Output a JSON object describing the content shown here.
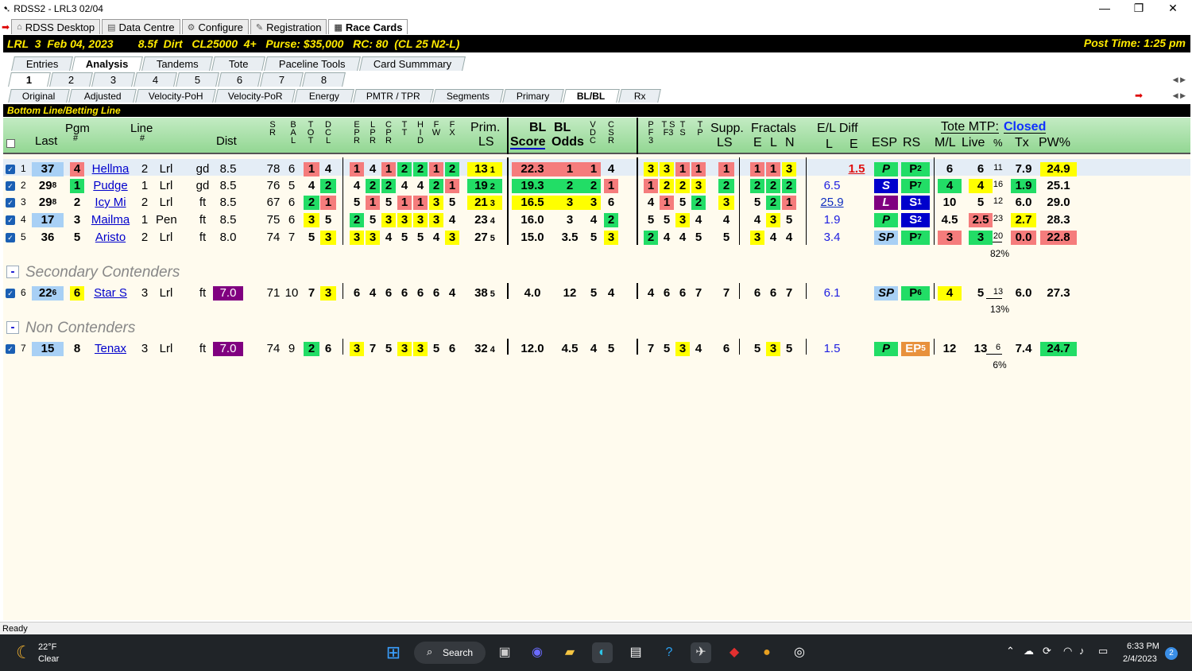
{
  "window": {
    "title": "RDSS2 - LRL3  02/04"
  },
  "app_tabs": [
    {
      "label": "RDSS Desktop"
    },
    {
      "label": "Data Centre"
    },
    {
      "label": "Configure"
    },
    {
      "label": "Registration"
    },
    {
      "label": "Race Cards"
    }
  ],
  "race": {
    "header": "LRL  3  Feb 04, 2023        8.5f  Dirt   CL25000  4+   Purse: $35,000   RC: 80  (CL 25 N2-L)",
    "post_time": "Post Time: 1:25 pm"
  },
  "main_tabs": [
    "Entries",
    "Analysis",
    "Tandems",
    "Tote",
    "Paceline Tools",
    "Card Summmary"
  ],
  "race_tabs": [
    "1",
    "2",
    "3",
    "4",
    "5",
    "6",
    "7",
    "8"
  ],
  "view_tabs": [
    "Original",
    "Adjusted",
    "Velocity-PoH",
    "Velocity-PoR",
    "Energy",
    "PMTR / TPR",
    "Segments",
    "Primary",
    "BL/BL",
    "Rx"
  ],
  "section_title": "Bottom Line/Betting Line",
  "headers": {
    "last": "Last",
    "pgm": "Pgm",
    "pgm_hash": "#",
    "line": "Line",
    "line_hash": "#",
    "dist": "Dist",
    "prim": "Prim.",
    "ls": "LS",
    "bl1": "BL",
    "bl2": "BL",
    "score": "Score",
    "odds": "Odds",
    "supp": "Supp.",
    "supp_ls": "LS",
    "fractals": "Fractals",
    "e": "E",
    "l": "L",
    "n": "N",
    "eldiff": "E/L Diff",
    "el_l": "L",
    "el_e": "E",
    "esp": "ESP",
    "rs": "RS",
    "tote_mtp": "Tote MTP:",
    "tote_status": "Closed",
    "ml": "M/L",
    "live": "Live",
    "pct": "%",
    "tx": "Tx",
    "pw": "PW%"
  },
  "small_headers": {
    "sr": "S R",
    "bal": "B A L",
    "tot": "T O T",
    "dcl": "D C L",
    "epr": "E P R",
    "lpr": "L P R",
    "cpr": "C P R",
    "tt": "T T",
    "hid": "H I D",
    "fw": "F W",
    "fx": "F X",
    "vdc": "V D C",
    "csr": "C S R",
    "pfs": "P F 3",
    "tsf": "T S F3",
    "ts": "T S",
    "tp": "T P"
  },
  "groups": {
    "secondary": "Secondary Contenders",
    "non": "Non Contenders"
  },
  "horses": [
    {
      "n": "1",
      "last": "37",
      "pgm": "4",
      "name": "Hellma",
      "line": "2",
      "trk": "Lrl",
      "sf": "gd",
      "dist": "8.5",
      "sr": "78",
      "bal": "6",
      "tot": "1",
      "dcl": "4",
      "e": [
        "1",
        "4",
        "1",
        "2",
        "2",
        "1",
        "2"
      ],
      "prim": "13",
      "primsub": "1",
      "score": "22.3",
      "odds": "1",
      "vdc": "1",
      "csr": "4",
      "pf": [
        "3",
        "3",
        "1",
        "1"
      ],
      "supp": "1",
      "fr": [
        "1",
        "1",
        "3"
      ],
      "ell": "",
      "ele": "1.5",
      "esp": "P",
      "rs": "P",
      "rssub": "2",
      "ml": "6",
      "live": "6",
      "pct": "11",
      "tx": "7.9",
      "pw": "24.9"
    },
    {
      "n": "2",
      "last": "29",
      "lastsub": "8",
      "pgm": "1",
      "name": "Pudge",
      "line": "1",
      "trk": "Lrl",
      "sf": "gd",
      "dist": "8.5",
      "sr": "76",
      "bal": "5",
      "tot": "4",
      "dcl": "2",
      "e": [
        "4",
        "2",
        "2",
        "4",
        "4",
        "2",
        "1"
      ],
      "prim": "19",
      "primsub": "2",
      "score": "19.3",
      "odds": "2",
      "vdc": "2",
      "csr": "1",
      "pf": [
        "1",
        "2",
        "2",
        "3"
      ],
      "supp": "2",
      "fr": [
        "2",
        "2",
        "2"
      ],
      "ell": "6.5",
      "ele": "",
      "esp": "S",
      "rs": "P",
      "rssub": "7",
      "ml": "4",
      "live": "4",
      "pct": "16",
      "tx": "1.9",
      "pw": "25.1"
    },
    {
      "n": "3",
      "last": "29",
      "lastsub": "8",
      "pgm": "2",
      "name": "Icy Mi",
      "line": "2",
      "trk": "Lrl",
      "sf": "ft",
      "dist": "8.5",
      "sr": "67",
      "bal": "6",
      "tot": "2",
      "dcl": "1",
      "e": [
        "5",
        "1",
        "5",
        "1",
        "1",
        "3",
        "5"
      ],
      "prim": "21",
      "primsub": "3",
      "score": "16.5",
      "odds": "3",
      "vdc": "3",
      "csr": "6",
      "pf": [
        "4",
        "1",
        "5",
        "2"
      ],
      "supp": "3",
      "fr": [
        "5",
        "2",
        "1"
      ],
      "ell": "25.9",
      "ele": "",
      "esp": "L",
      "rs": "S",
      "rssub": "1",
      "ml": "10",
      "live": "5",
      "pct": "12",
      "tx": "6.0",
      "pw": "29.0"
    },
    {
      "n": "4",
      "last": "17",
      "pgm": "3",
      "name": "Mailma",
      "line": "1",
      "trk": "Pen",
      "sf": "ft",
      "dist": "8.5",
      "sr": "75",
      "bal": "6",
      "tot": "3",
      "dcl": "5",
      "e": [
        "2",
        "5",
        "3",
        "3",
        "3",
        "3",
        "4"
      ],
      "prim": "23",
      "primsub": "4",
      "score": "16.0",
      "odds": "3",
      "vdc": "4",
      "csr": "2",
      "pf": [
        "5",
        "5",
        "3",
        "4"
      ],
      "supp": "4",
      "fr": [
        "4",
        "3",
        "5"
      ],
      "ell": "1.9",
      "ele": "",
      "esp": "P",
      "rs": "S",
      "rssub": "2",
      "ml": "4.5",
      "live": "2.5",
      "pct": "23",
      "tx": "2.7",
      "pw": "28.3"
    },
    {
      "n": "5",
      "last": "36",
      "pgm": "5",
      "name": "Aristo",
      "line": "2",
      "trk": "Lrl",
      "sf": "ft",
      "dist": "8.0",
      "sr": "74",
      "bal": "7",
      "tot": "5",
      "dcl": "3",
      "e": [
        "3",
        "3",
        "4",
        "5",
        "5",
        "4",
        "3"
      ],
      "prim": "27",
      "primsub": "5",
      "score": "15.0",
      "odds": "3.5",
      "vdc": "5",
      "csr": "3",
      "pf": [
        "2",
        "4",
        "4",
        "5"
      ],
      "supp": "5",
      "fr": [
        "3",
        "4",
        "4"
      ],
      "ell": "3.4",
      "ele": "",
      "esp": "SP",
      "rs": "P",
      "rssub": "7",
      "ml": "3",
      "live": "3",
      "pct": "20",
      "tx": "0.0",
      "pw": "22.8",
      "sumpct": "82%"
    },
    {
      "n": "6",
      "last": "22",
      "lastsub": "6",
      "pgm": "6",
      "name": "Star S",
      "line": "3",
      "trk": "Lrl",
      "sf": "ft",
      "dist": "7.0",
      "sr": "71",
      "bal": "10",
      "tot": "7",
      "dcl": "3",
      "e": [
        "6",
        "4",
        "6",
        "6",
        "6",
        "6",
        "4"
      ],
      "prim": "38",
      "primsub": "5",
      "score": "4.0",
      "odds": "12",
      "vdc": "5",
      "csr": "4",
      "pf": [
        "4",
        "6",
        "6",
        "7"
      ],
      "supp": "7",
      "fr": [
        "6",
        "6",
        "7"
      ],
      "ell": "6.1",
      "ele": "",
      "esp": "SP",
      "rs": "P",
      "rssub": "6",
      "ml": "4",
      "live": "5",
      "pct": "13",
      "tx": "6.0",
      "pw": "27.3",
      "sumpct": "13%"
    },
    {
      "n": "7",
      "last": "15",
      "pgm": "8",
      "name": "Tenax",
      "line": "3",
      "trk": "Lrl",
      "sf": "ft",
      "dist": "7.0",
      "sr": "74",
      "bal": "9",
      "tot": "2",
      "dcl": "6",
      "e": [
        "3",
        "7",
        "5",
        "3",
        "3",
        "5",
        "6"
      ],
      "prim": "32",
      "primsub": "4",
      "score": "12.0",
      "odds": "4.5",
      "vdc": "4",
      "csr": "5",
      "pf": [
        "7",
        "5",
        "3",
        "4"
      ],
      "supp": "6",
      "fr": [
        "5",
        "3",
        "5"
      ],
      "ell": "1.5",
      "ele": "",
      "esp": "P",
      "rs": "EP",
      "rssub": "5",
      "ml": "12",
      "live": "13",
      "pct": "6",
      "tx": "7.4",
      "pw": "24.7",
      "sumpct": "6%"
    }
  ],
  "status": "Ready",
  "taskbar": {
    "temp": "22°F",
    "weather": "Clear",
    "search": "Search",
    "time": "6:33 PM",
    "date": "2/4/2023",
    "badge": "2"
  }
}
